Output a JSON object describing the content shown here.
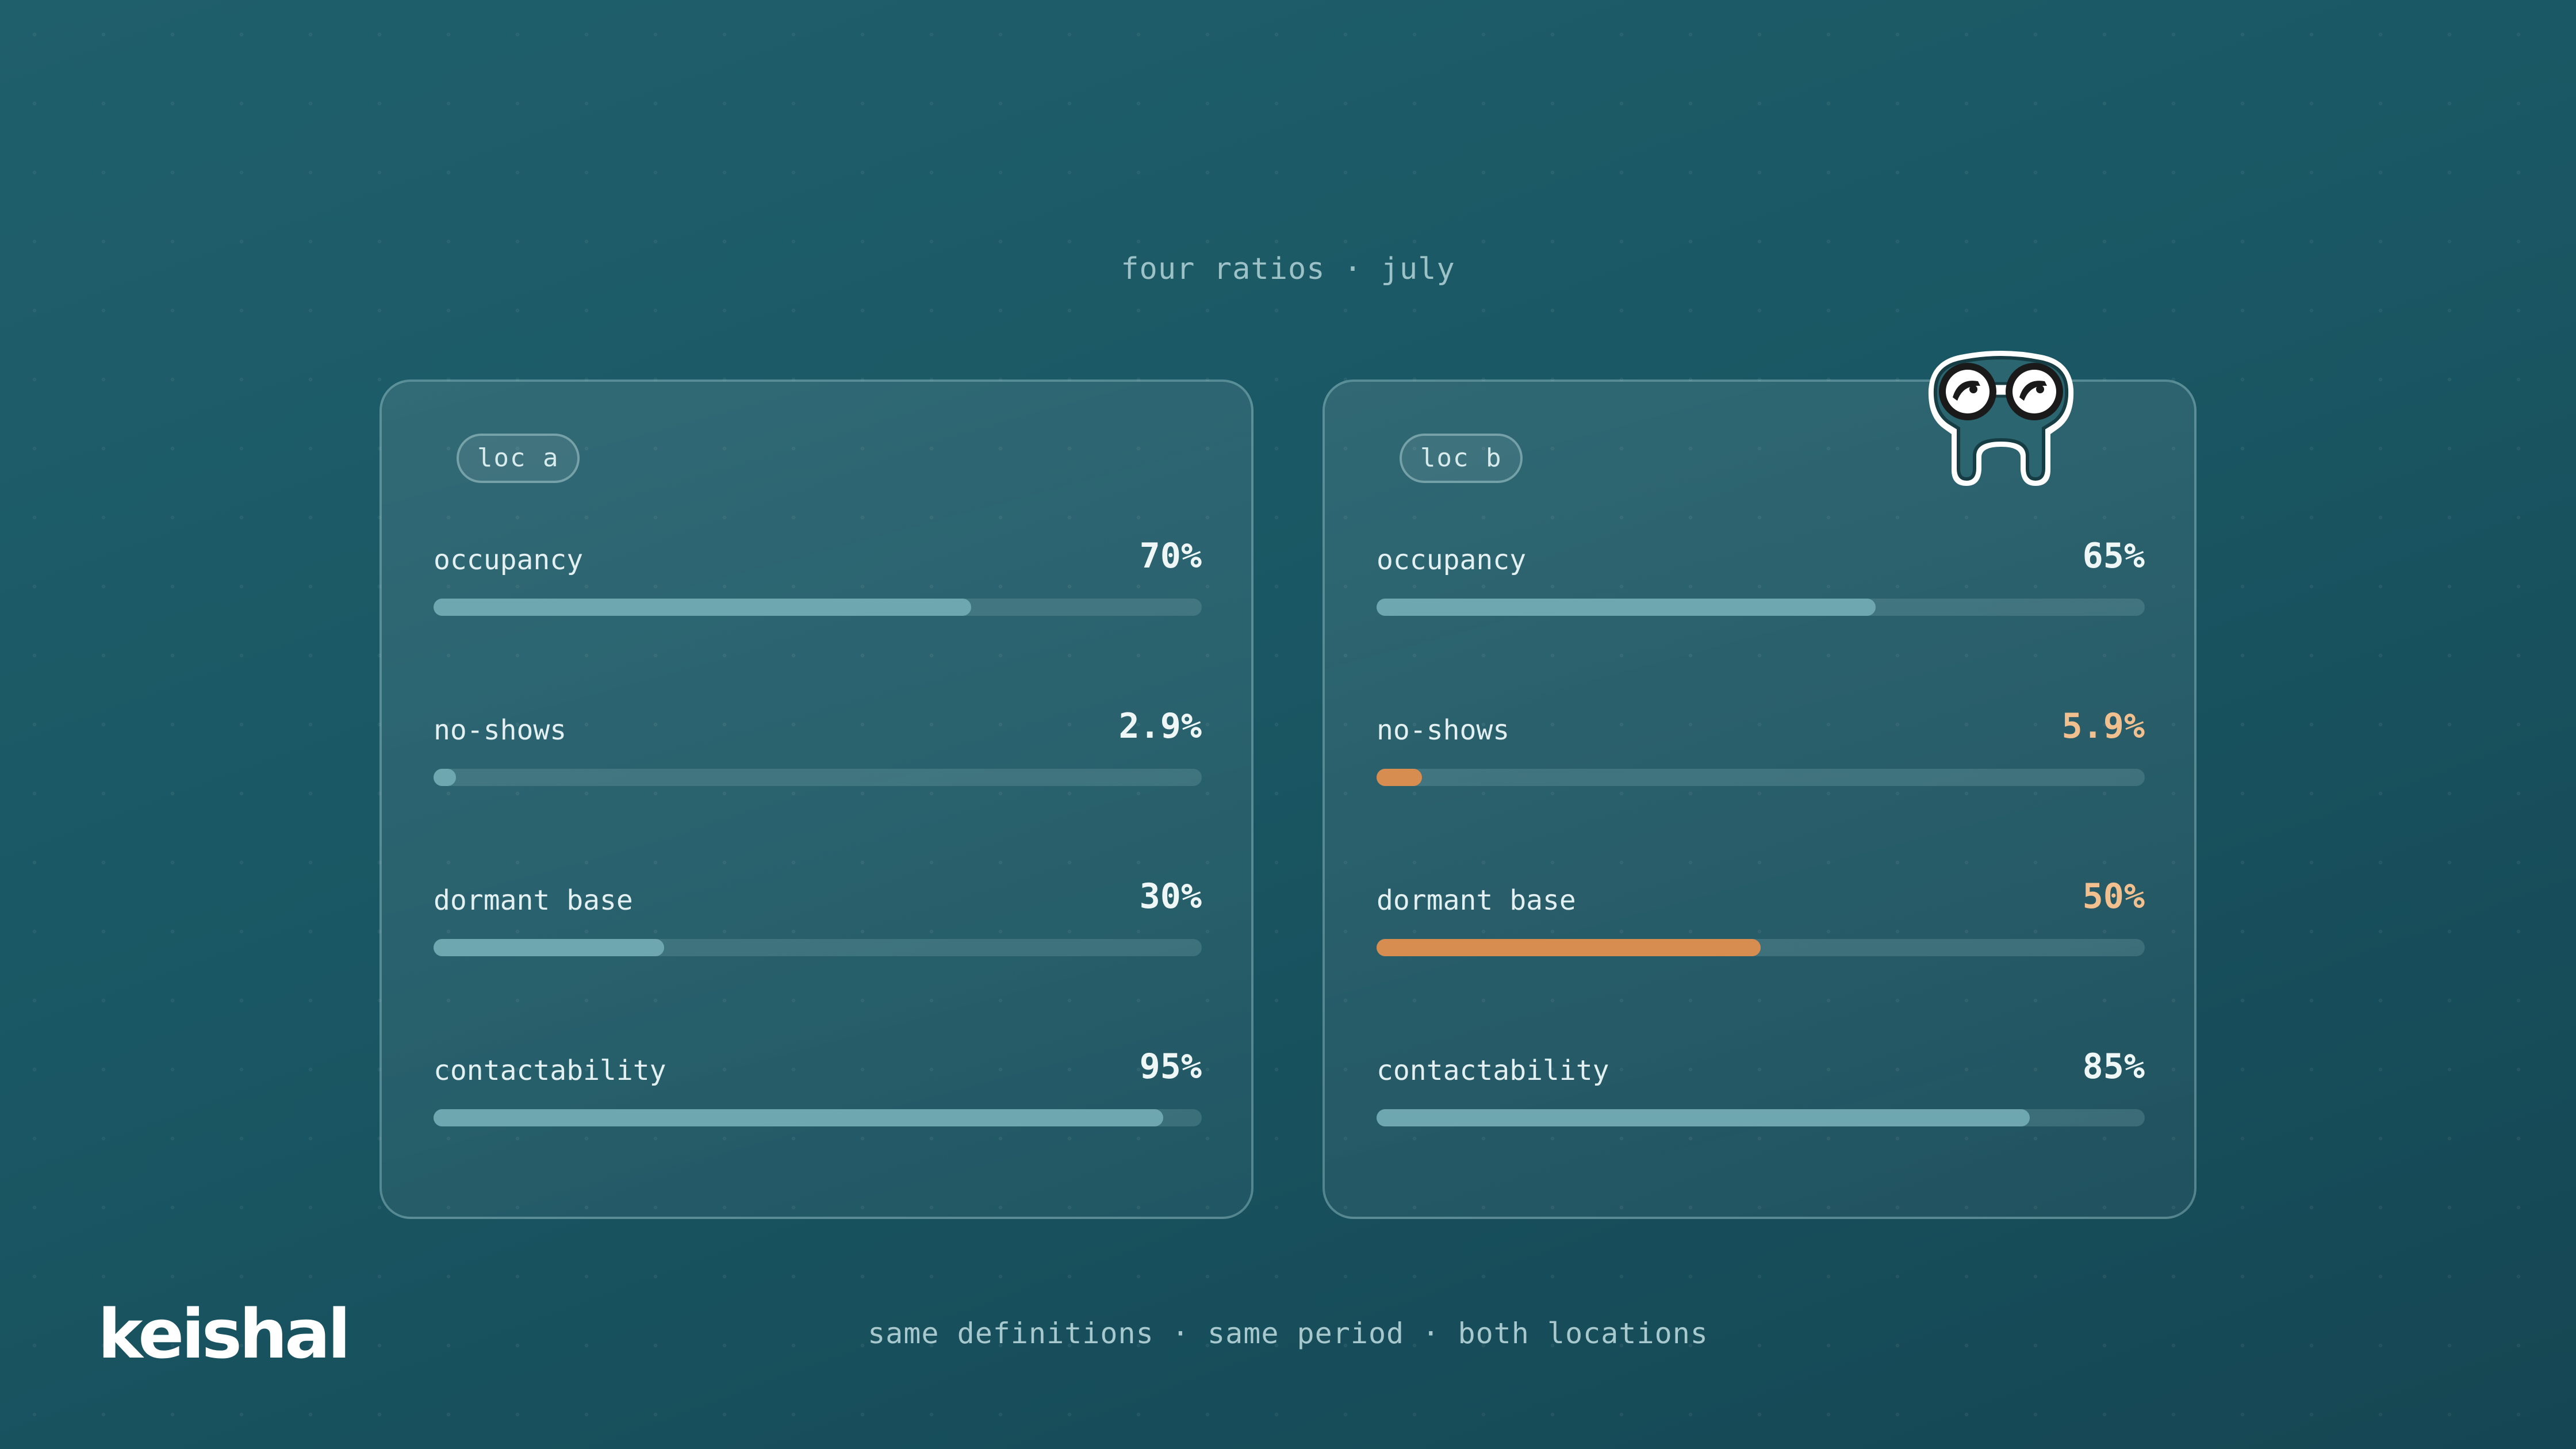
{
  "page": {
    "title": "four ratios · july",
    "footer": "same definitions · same period · both locations",
    "brand": "keishal"
  },
  "locations": [
    {
      "tag": "loc a",
      "metrics": [
        {
          "label": "occupancy",
          "value_text": "70%",
          "fraction": 0.7,
          "highlight": false
        },
        {
          "label": "no-shows",
          "value_text": "2.9%",
          "fraction": 0.029,
          "highlight": false
        },
        {
          "label": "dormant base",
          "value_text": "30%",
          "fraction": 0.3,
          "highlight": false
        },
        {
          "label": "contactability",
          "value_text": "95%",
          "fraction": 0.95,
          "highlight": false
        }
      ]
    },
    {
      "tag": "loc b",
      "metrics": [
        {
          "label": "occupancy",
          "value_text": "65%",
          "fraction": 0.65,
          "highlight": false
        },
        {
          "label": "no-shows",
          "value_text": "5.9%",
          "fraction": 0.059,
          "highlight": true
        },
        {
          "label": "dormant base",
          "value_text": "50%",
          "fraction": 0.5,
          "highlight": true
        },
        {
          "label": "contactability",
          "value_text": "85%",
          "fraction": 0.85,
          "highlight": false
        }
      ]
    }
  ],
  "mascot": {
    "icon": "binoculars-mascot-icon"
  },
  "colors": {
    "background": "#1a5764",
    "bar_normal": "#6ea7b0",
    "bar_highlight": "#d78d4f",
    "value_highlight": "#f2c08e"
  }
}
